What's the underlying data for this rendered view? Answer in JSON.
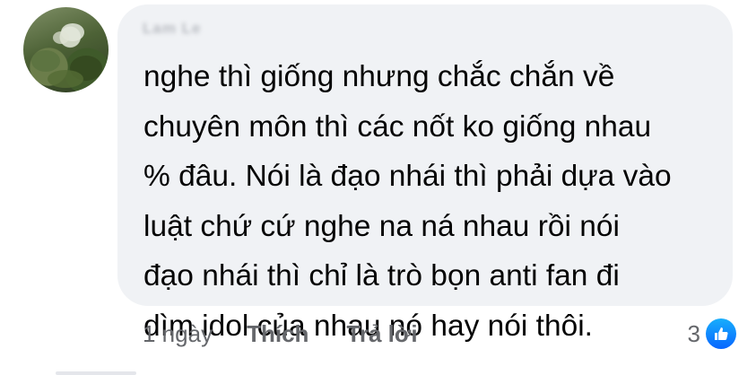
{
  "comment": {
    "author_name": "Lam Le",
    "text": "nghe thì giống nhưng chắc chắn về\nchuyên môn thì các nốt ko giống nhau\n% đâu. Nói là đạo nhái thì phải dựa vào\nluật chứ cứ nghe na ná nhau rồi nói\nđạo nhái thì chỉ là trò bọn anti fan đi\ndìm idol của nhau nó hay nói thôi."
  },
  "actions": {
    "time": "1 ngày",
    "like_label": "Thích",
    "reply_label": "Trả lời"
  },
  "reactions": {
    "count": "3",
    "icon": "like-thumb-icon",
    "color": "#0866ff"
  },
  "colors": {
    "bubble": "#f0f2f5",
    "text": "#050505",
    "meta": "#65676b"
  }
}
